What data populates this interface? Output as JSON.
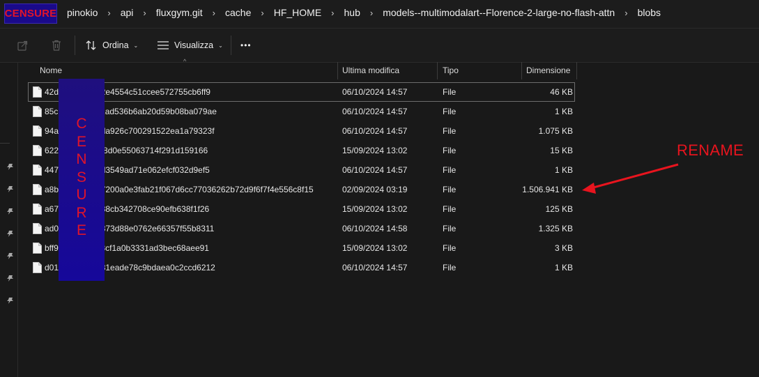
{
  "censor_label": "CENSURE",
  "censor_letters": [
    "C",
    "E",
    "N",
    "S",
    "U",
    "R",
    "E"
  ],
  "breadcrumb": [
    "pinokio",
    "api",
    "fluxgym.git",
    "cache",
    "HF_HOME",
    "hub",
    "models--multimodalart--Florence-2-large-no-flash-attn",
    "blobs"
  ],
  "breadcrumb_separator": "›",
  "toolbar": {
    "share_icon": "share-icon",
    "delete_icon": "trash-icon",
    "sort_label": "Ordina",
    "view_label": "Visualizza",
    "more_label": "•••"
  },
  "columns": {
    "name": "Nome",
    "modified": "Ultima modifica",
    "type": "Tipo",
    "size": "Dimensione"
  },
  "files": [
    {
      "name": "42d",
      "hash_tail": "d2e4554c51ccee572755cb6ff9",
      "modified": "06/10/2024 14:57",
      "type": "File",
      "size": "46 KB"
    },
    {
      "name": "85c",
      "hash_tail": "61ad536b6ab20d59b08ba079ae",
      "modified": "06/10/2024 14:57",
      "type": "File",
      "size": "1 KB"
    },
    {
      "name": "94a",
      "hash_tail": "oda926c700291522ea1a79323f",
      "modified": "06/10/2024 14:57",
      "type": "File",
      "size": "1.075 KB"
    },
    {
      "name": "622",
      "hash_tail": "f68d0e55063714f291d159166",
      "modified": "15/09/2024 13:02",
      "type": "File",
      "size": "15 KB"
    },
    {
      "name": "447",
      "hash_tail": "8d3549ad71e062efcf032d9ef5",
      "modified": "06/10/2024 14:57",
      "type": "File",
      "size": "1 KB"
    },
    {
      "name": "a8b",
      "hash_tail": "57200a0e3fab21f067d6cc77036262b72d9f6f7f4e556c8f15",
      "modified": "02/09/2024 03:19",
      "type": "File",
      "size": "1.506.941 KB"
    },
    {
      "name": "a67",
      "hash_tail": "d38cb342708ce90efb638f1f26",
      "modified": "15/09/2024 13:02",
      "type": "File",
      "size": "125 KB"
    },
    {
      "name": "ad0",
      "hash_tail": "1373d88e0762e66357f55b8311",
      "modified": "06/10/2024 14:58",
      "type": "File",
      "size": "1.325 KB"
    },
    {
      "name": "bff9",
      "hash_tail": "6c8cf1a0b3331ad3bec68aee91",
      "modified": "15/09/2024 13:02",
      "type": "File",
      "size": "3 KB"
    },
    {
      "name": "d01",
      "hash_tail": "731eade78c9bdaea0c2ccd6212",
      "modified": "06/10/2024 14:57",
      "type": "File",
      "size": "1 KB"
    }
  ],
  "annotation": {
    "text": "RENAME",
    "color": "#e8141e"
  },
  "colors": {
    "background": "#191919",
    "censor_bg": "#1a0a8a",
    "censor_text": "#e0142a"
  }
}
